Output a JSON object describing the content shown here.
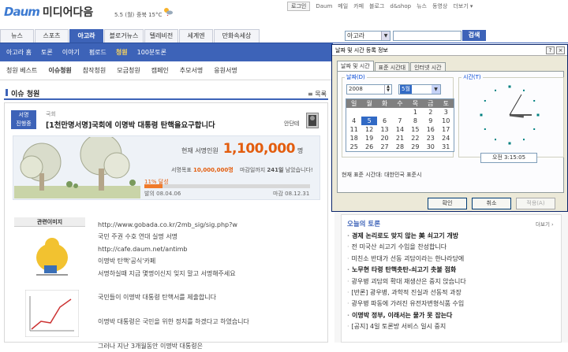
{
  "brand": {
    "logo_text": "Daum",
    "site_name": "미디어다음",
    "date": "5.5 (월)",
    "weather": "중북 15°C"
  },
  "util": {
    "login": "로그인",
    "links": [
      "Daum",
      "메일",
      "카페",
      "블로그",
      "d&shop",
      "뉴스",
      "동영상",
      "더보기 ▾"
    ]
  },
  "search": {
    "category": "아고라",
    "button": "검색",
    "value": ""
  },
  "tabs": [
    "뉴스",
    "스포츠",
    "아고라",
    "블로거뉴스",
    "텔레비전",
    "세계엔",
    "만화속세상"
  ],
  "subnav": [
    "아고라 홈",
    "토론",
    "이야기",
    "펌로드",
    "청원",
    "100분토론"
  ],
  "subnav2": [
    "청원 베스트",
    "이슈청원",
    "참작청원",
    "모금청원",
    "캠페인",
    "추모서명",
    "응원서명"
  ],
  "section": {
    "title": "이슈 청원",
    "list_btn": "목록"
  },
  "petition": {
    "badge_line1": "서명",
    "badge_line2": "진행중",
    "category": "국회",
    "title": "[1천만명서명]국회에 이명박 대통령 탄핵을요구합니다",
    "author": "안단테",
    "current_label": "현재 서명인원",
    "current_value": "1,100,000",
    "current_unit": "명",
    "goal_label": "서명목표",
    "goal_value": "10,000,000명",
    "remain_label": "마감일까지",
    "remain_value": "241일",
    "remain_suffix": "남았습니다!",
    "progress_label": "11% 달성",
    "progress": 0.11,
    "start_label": "발의",
    "start_date": "08.04.06",
    "end_label": "마감",
    "end_date": "08.12.31"
  },
  "related": {
    "title": "관련이미지"
  },
  "body_lines": [
    "http://www.gobada.co.kr/2mb_sig/sig.php?w",
    "국민 주권 수호 연대 실명 서명",
    "http://cafe.daum.net/antimb",
    "이명박 탄핵'공식'카페",
    "서명하실때 지금 몇명이신지 잊지 말고 서명해주세요",
    "",
    "국민들이 이명박 대통령 탄핵서를 제출합니다",
    "",
    "이명박 대통령은 국민을 위한 정치를 하겠다고 하였습니다",
    "",
    "그러나 지난 3개월동안 이명박 대통령은"
  ],
  "dialog": {
    "title": "날짜 및 시간 등록 정보",
    "help": "?",
    "close": "×",
    "tabs": [
      "날짜 및 시간",
      "표준 시간대",
      "인터넷 시간"
    ],
    "date_group": "날짜(D)",
    "year": "2008",
    "month": "5월",
    "time_group": "시간(T)",
    "weekdays": [
      "일",
      "월",
      "화",
      "수",
      "목",
      "금",
      "토"
    ],
    "weeks": [
      [
        "",
        "",
        "",
        "",
        "1",
        "2",
        "3"
      ],
      [
        "4",
        "5",
        "6",
        "7",
        "8",
        "9",
        "10"
      ],
      [
        "11",
        "12",
        "13",
        "14",
        "15",
        "16",
        "17"
      ],
      [
        "18",
        "19",
        "20",
        "21",
        "22",
        "23",
        "24"
      ],
      [
        "25",
        "26",
        "27",
        "28",
        "29",
        "30",
        "31"
      ]
    ],
    "selected_day": "5",
    "time_value": "오전  3:15:05",
    "timezone": "현재 표준 시간대: 대한민국 표준시",
    "ok": "확인",
    "cancel": "취소",
    "apply": "적용(A)"
  },
  "debate": {
    "title": "오늘의 토론",
    "more": "더보기 ›",
    "items": [
      "경제 논리로도 맞지 않는 美 쇠고기 개방",
      "전 미국산 쇠고기 수입을 찬성합니다",
      "미친소 반대가 선동 괴담이라는 한나라당에",
      "노무현 타령 탄핵촛탄-쇠고기 촛불 점화",
      "광우병 괴담의 확대 재생산은 중지 앉습니다",
      "[반론] 광우병, 과학적 진실과 선동적 과장",
      "광우병 파동에 가려진 유전자변형식품 수입",
      "이명박 정부, 이래서는 물가 못 잡는다",
      "[공지] 4일 토론방 서비스 일시 중지"
    ]
  },
  "colors": {
    "accent": "#3d63b8",
    "highlight": "#ffd85a",
    "progress": "#f07a2a",
    "value": "#e35d0e"
  }
}
